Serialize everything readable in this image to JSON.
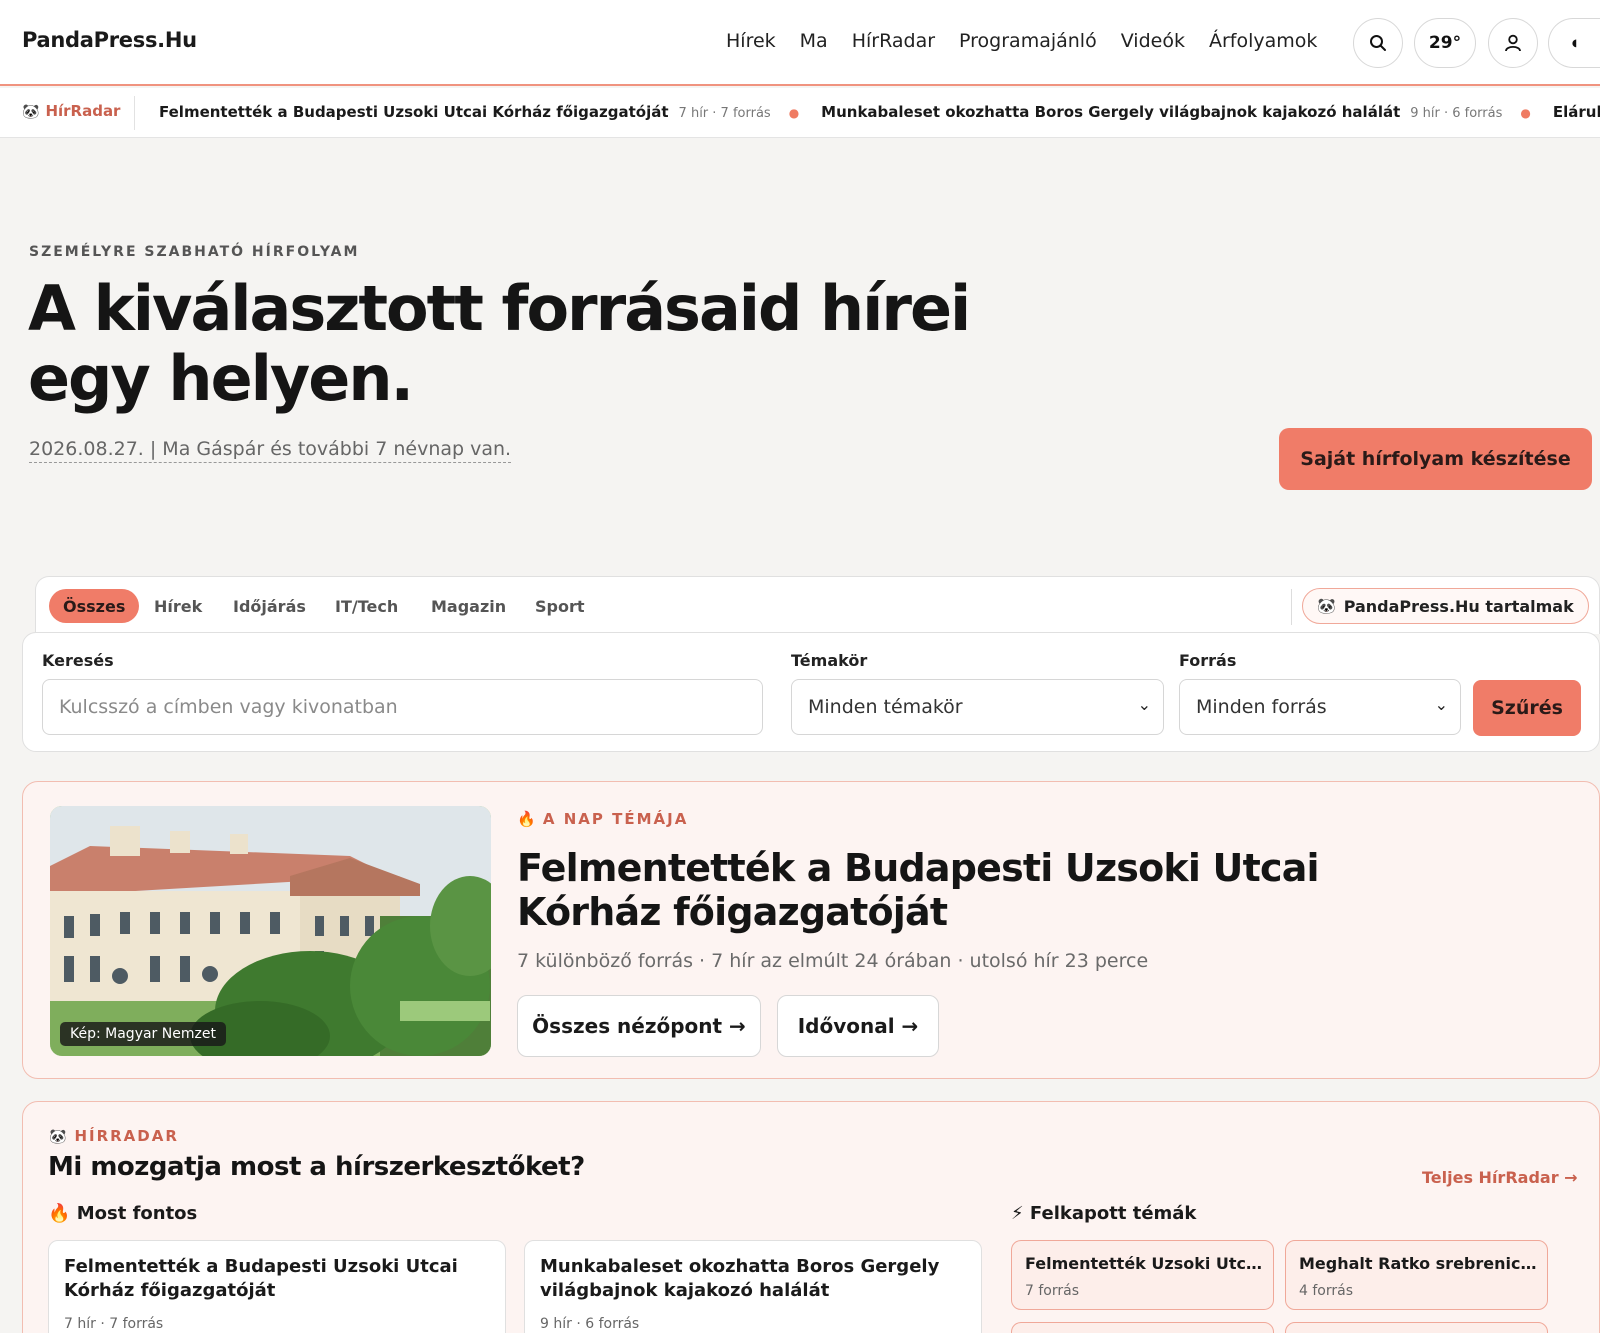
{
  "header": {
    "logo": "PandaPress.Hu",
    "nav": [
      "Hírek",
      "Ma",
      "HírRadar",
      "Programajánló",
      "Videók",
      "Árfolyamok"
    ],
    "temperature": "29°"
  },
  "ticker": {
    "brand": "HírRadar",
    "items": [
      {
        "title": "Felmentették a Budapesti Uzsoki Utcai Kórház főigazgatóját",
        "meta": "7 hír · 7 forrás"
      },
      {
        "title": "Munkabaleset okozhatta Boros Gergely világbajnok kajakozó halálát",
        "meta": "9 hír · 6 forrás"
      },
      {
        "title": "Elárulta a Tisza",
        "meta": ""
      }
    ]
  },
  "hero": {
    "kicker": "SZEMÉLYRE SZABHATÓ HÍRFOLYAM",
    "title": "A kiválasztott forrásaid hírei egy helyen.",
    "date_line": "2026.08.27. | Ma Gáspár és további 7 névnap van.",
    "cta": "Saját hírfolyam készítése"
  },
  "filters": {
    "tabs": [
      "Összes",
      "Hírek",
      "Időjárás",
      "IT/Tech",
      "Magazin",
      "Sport"
    ],
    "active_tab": "Összes",
    "own_content": "PandaPress.Hu tartalmak",
    "search_label": "Keresés",
    "search_placeholder": "Kulcsszó a címben vagy kivonatban",
    "topic_label": "Témakör",
    "topic_value": "Minden témakör",
    "source_label": "Forrás",
    "source_value": "Minden forrás",
    "submit": "Szűrés"
  },
  "featured": {
    "kicker": "A NAP TÉMÁJA",
    "title": "Felmentették a Budapesti Uzsoki Utcai Kórház főigazgatóját",
    "meta": "7 különböző forrás · 7 hír az elmúlt 24 órában · utolsó hír 23 perce",
    "image_credit": "Kép: Magyar Nemzet",
    "btn_views": "Összes nézőpont →",
    "btn_timeline": "Idővonal →"
  },
  "radar": {
    "kicker": "HÍRRADAR",
    "title": "Mi mozgatja most a hírszerkesztőket?",
    "full_link": "Teljes HírRadar →",
    "top_label": "Most fontos",
    "trend_label": "Felkapott témák",
    "top": [
      {
        "title": "Felmentették a Budapesti Uzsoki Utcai Kórház főigazgatóját",
        "meta": "7 hír · 7 forrás"
      },
      {
        "title": "Munkabaleset okozhatta Boros Gergely világbajnok kajakozó halálát",
        "meta": "9 hír · 6 forrás"
      }
    ],
    "trending": [
      {
        "title": "Felmentették Uzsoki Utcai ...",
        "meta": "7 forrás"
      },
      {
        "title": "Meghalt Ratko srebrenicai ...",
        "meta": "4 forrás"
      }
    ]
  },
  "colors": {
    "accent": "#f07c68",
    "accent_text": "#c9614e",
    "card_tint": "#fdf4f2"
  },
  "icons": [
    "search-icon",
    "user-icon",
    "panda-icon",
    "fire-icon",
    "lightning-icon",
    "chevron-down-icon"
  ]
}
